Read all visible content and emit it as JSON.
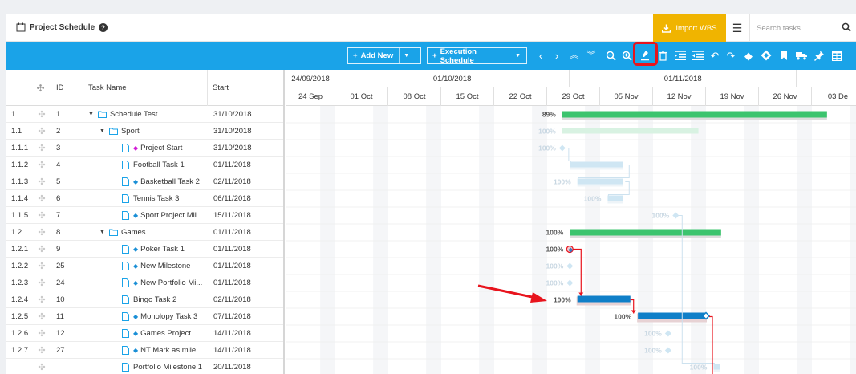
{
  "header": {
    "title": "Project Schedule",
    "import_label": "Import WBS",
    "search_placeholder": "Search tasks"
  },
  "toolbar": {
    "add_new_label": "Add New",
    "execution_label": "Execution Schedule",
    "icons": [
      "chevron-left-icon",
      "chevron-right-icon",
      "expand-all-icon",
      "collapse-all-icon",
      "zoom-out-icon",
      "zoom-in-icon",
      "highlight-icon",
      "delete-icon",
      "indent-icon",
      "outdent-icon",
      "undo-icon",
      "redo-icon",
      "milestone-icon",
      "baseline-milestone-icon",
      "bookmark-icon",
      "truck-icon",
      "pin-icon",
      "table-icon"
    ]
  },
  "grid": {
    "columns": [
      "ID",
      "Task Name",
      "Start"
    ],
    "rows": [
      {
        "wbs": "1",
        "id": "1",
        "name": "Schedule Test",
        "start": "31/10/2018",
        "level": 0,
        "type": "folder",
        "marker": ""
      },
      {
        "wbs": "1.1",
        "id": "2",
        "name": "Sport",
        "start": "31/10/2018",
        "level": 1,
        "type": "folder",
        "marker": ""
      },
      {
        "wbs": "1.1.1",
        "id": "3",
        "name": "Project Start",
        "start": "31/10/2018",
        "level": 2,
        "type": "doc",
        "marker": "magenta"
      },
      {
        "wbs": "1.1.2",
        "id": "4",
        "name": "Football Task 1",
        "start": "01/11/2018",
        "level": 2,
        "type": "doc",
        "marker": ""
      },
      {
        "wbs": "1.1.3",
        "id": "5",
        "name": "Basketball Task 2",
        "start": "02/11/2018",
        "level": 2,
        "type": "doc",
        "marker": "blue"
      },
      {
        "wbs": "1.1.4",
        "id": "6",
        "name": "Tennis Task 3",
        "start": "06/11/2018",
        "level": 2,
        "type": "doc",
        "marker": ""
      },
      {
        "wbs": "1.1.5",
        "id": "7",
        "name": "Sport Project Mil...",
        "start": "15/11/2018",
        "level": 2,
        "type": "doc",
        "marker": "blue"
      },
      {
        "wbs": "1.2",
        "id": "8",
        "name": "Games",
        "start": "01/11/2018",
        "level": 1,
        "type": "folder",
        "marker": ""
      },
      {
        "wbs": "1.2.1",
        "id": "9",
        "name": "Poker Task 1",
        "start": "01/11/2018",
        "level": 2,
        "type": "doc",
        "marker": "blue"
      },
      {
        "wbs": "1.2.2",
        "id": "25",
        "name": "New Milestone",
        "start": "01/11/2018",
        "level": 2,
        "type": "doc",
        "marker": "blue"
      },
      {
        "wbs": "1.2.3",
        "id": "24",
        "name": "New Portfolio Mi...",
        "start": "01/11/2018",
        "level": 2,
        "type": "doc",
        "marker": "blue"
      },
      {
        "wbs": "1.2.4",
        "id": "10",
        "name": "Bingo Task 2",
        "start": "02/11/2018",
        "level": 2,
        "type": "doc",
        "marker": ""
      },
      {
        "wbs": "1.2.5",
        "id": "11",
        "name": "Monolopy Task 3",
        "start": "07/11/2018",
        "level": 2,
        "type": "doc",
        "marker": "blue"
      },
      {
        "wbs": "1.2.6",
        "id": "12",
        "name": "Games Project...",
        "start": "14/11/2018",
        "level": 2,
        "type": "doc",
        "marker": "blue"
      },
      {
        "wbs": "1.2.7",
        "id": "27",
        "name": "NT Mark as mile...",
        "start": "14/11/2018",
        "level": 2,
        "type": "doc",
        "marker": "blue"
      },
      {
        "wbs": "",
        "id": "",
        "name": "Portfolio Milestone 1",
        "start": "20/11/2018",
        "level": 2,
        "type": "doc",
        "marker": ""
      }
    ]
  },
  "timeline": {
    "top": [
      {
        "label": "24/09/2018",
        "days": 7
      },
      {
        "label": "01/10/2018",
        "days": 31
      },
      {
        "label": "01/11/2018",
        "days": 30
      },
      {
        "label": "",
        "days": 6
      }
    ],
    "weeks": [
      "24 Sep",
      "01 Oct",
      "08 Oct",
      "15 Oct",
      "22 Oct",
      "29 Oct",
      "05 Nov",
      "12 Nov",
      "19 Nov",
      "26 Nov",
      "03 De"
    ],
    "start_date": "2018-09-24"
  },
  "bars": [
    {
      "row": 0,
      "start": "2018-10-31",
      "end": "2018-12-05",
      "kind": "summary",
      "progress": "89%"
    },
    {
      "row": 1,
      "start": "2018-10-31",
      "end": "2018-11-18",
      "kind": "summary-faded",
      "progress": "100%"
    },
    {
      "row": 2,
      "start": "2018-10-31",
      "end": "2018-10-31",
      "kind": "milestone-faded",
      "progress": "100%"
    },
    {
      "row": 3,
      "start": "2018-11-01",
      "end": "2018-11-08",
      "kind": "task-faded",
      "progress": ""
    },
    {
      "row": 4,
      "start": "2018-11-02",
      "end": "2018-11-08",
      "kind": "task-faded",
      "progress": "100%"
    },
    {
      "row": 5,
      "start": "2018-11-06",
      "end": "2018-11-08",
      "kind": "task-faded",
      "progress": "100%"
    },
    {
      "row": 6,
      "start": "2018-11-15",
      "end": "2018-11-15",
      "kind": "milestone-faded",
      "progress": "100%"
    },
    {
      "row": 7,
      "start": "2018-11-01",
      "end": "2018-11-21",
      "kind": "summary",
      "progress": "100%"
    },
    {
      "row": 8,
      "start": "2018-11-01",
      "end": "2018-11-01",
      "kind": "milestone-sel",
      "progress": "100%"
    },
    {
      "row": 9,
      "start": "2018-11-01",
      "end": "2018-11-01",
      "kind": "milestone-faded",
      "progress": "100%"
    },
    {
      "row": 10,
      "start": "2018-11-01",
      "end": "2018-11-01",
      "kind": "milestone-faded",
      "progress": "100%"
    },
    {
      "row": 11,
      "start": "2018-11-02",
      "end": "2018-11-09",
      "kind": "task",
      "progress": "100%"
    },
    {
      "row": 12,
      "start": "2018-11-10",
      "end": "2018-11-19",
      "kind": "task",
      "progress": "100%"
    },
    {
      "row": 13,
      "start": "2018-11-14",
      "end": "2018-11-14",
      "kind": "milestone-faded",
      "progress": "100%"
    },
    {
      "row": 14,
      "start": "2018-11-14",
      "end": "2018-11-14",
      "kind": "milestone-faded",
      "progress": "100%"
    },
    {
      "row": 15,
      "start": "2018-11-20",
      "end": "2018-11-20",
      "kind": "task-faded",
      "progress": "100%"
    }
  ],
  "colors": {
    "toolbar": "#1aa3e8",
    "import": "#f0b400",
    "summary": "#3cc46e",
    "task": "#0f7fc8",
    "faded": "#cfe6f3",
    "dependency": "#e8141d",
    "annotation": "#e8141d"
  }
}
